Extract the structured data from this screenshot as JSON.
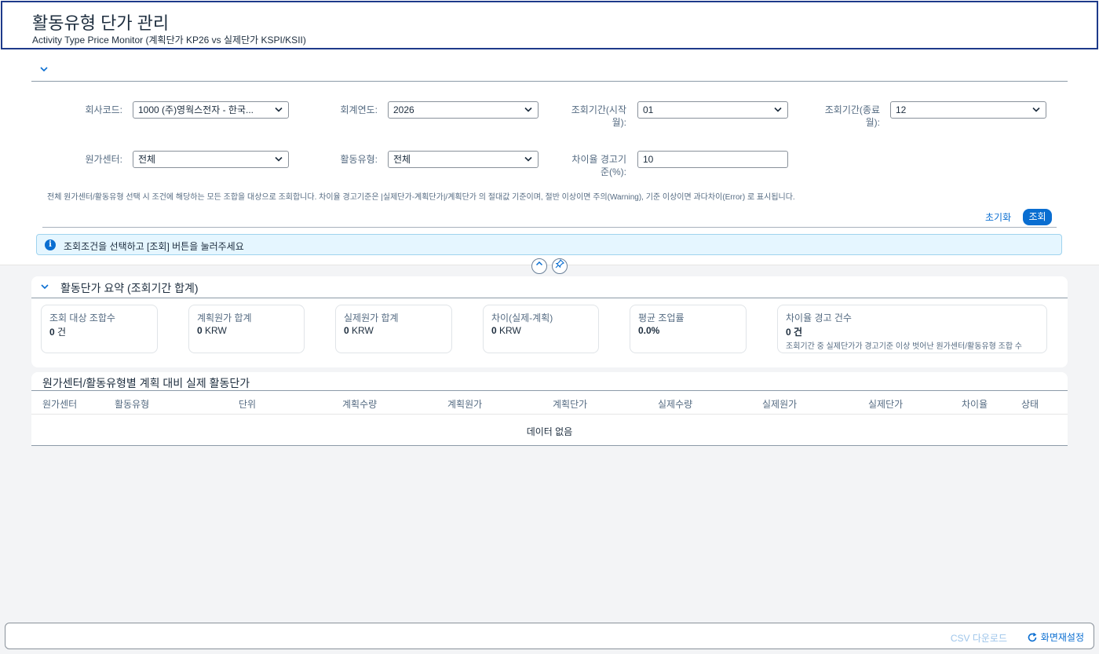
{
  "header": {
    "title": "활동유형 단가 관리",
    "subtitle": "Activity Type Price Monitor (계획단가 KP26 vs 실제단가 KSPI/KSII)"
  },
  "filters": {
    "company_code": {
      "label": "회사코드:",
      "value": "1000 (주)영웍스전자 - 한국..."
    },
    "fiscal_year": {
      "label": "회계연도:",
      "value": "2026"
    },
    "period_from": {
      "label_1": "조회기간(시작",
      "label_2": "월):",
      "value": "01"
    },
    "period_to": {
      "label_1": "조회기간(종료",
      "label_2": "월):",
      "value": "12"
    },
    "cost_center": {
      "label": "원가센터:",
      "value": "전체"
    },
    "activity_type": {
      "label": "활동유형:",
      "value": "전체"
    },
    "variance_threshold": {
      "label_1": "차이율 경고기",
      "label_2": "준(%):",
      "value": "10"
    },
    "hint": "전체 원가센터/활동유형 선택 시 조건에 해당하는 모든 조합을 대상으로 조회합니다. 차이율 경고기준은 |실제단가-계획단가|/계획단가 의 절대값 기준이며, 절반 이상이면 주의(Warning), 기준 이상이면 과다차이(Error) 로 표시됩니다.",
    "reset_label": "초기화",
    "query_label": "조회"
  },
  "info_message": "조회조건을 선택하고 [조회] 버튼을 눌러주세요",
  "summary": {
    "title": "활동단가 요약 (조회기간 합계)",
    "cards": [
      {
        "label": "조회 대상 조합수",
        "value": "0",
        "unit": " 건"
      },
      {
        "label": "계획원가 합계",
        "value": "0",
        "unit": " KRW"
      },
      {
        "label": "실제원가 합계",
        "value": "0",
        "unit": " KRW"
      },
      {
        "label": "차이(실제-계획)",
        "value": "0",
        "unit": " KRW"
      },
      {
        "label": "평균 조업률",
        "value": "0.0%",
        "unit": ""
      },
      {
        "label": "차이율 경고 건수",
        "value": "0 건",
        "sub": "조회기간 중 실제단가가 경고기준 이상 벗어난 원가센터/활동유형 조합 수"
      }
    ]
  },
  "table": {
    "title": "원가센터/활동유형별 계획 대비 실제 활동단가",
    "columns": [
      "원가센터",
      "활동유형",
      "단위",
      "계획수량",
      "계획원가",
      "계획단가",
      "실제수량",
      "실제원가",
      "실제단가",
      "차이율",
      "상태"
    ],
    "empty_text": "데이터 없음"
  },
  "footer": {
    "csv_label": "CSV 다운로드",
    "reset_view_label": "화면재설정"
  },
  "colors": {
    "accent": "#0a6ed1",
    "title_border": "#1e3a8a",
    "info_bg": "#e5f6ff",
    "warning_red": "#d20a0a"
  }
}
